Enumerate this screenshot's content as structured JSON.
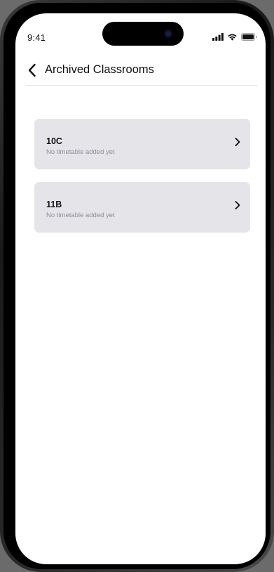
{
  "status_bar": {
    "time": "9:41"
  },
  "nav": {
    "title": "Archived Classrooms",
    "back_icon": "chevron-left-icon"
  },
  "classrooms": [
    {
      "name": "10C",
      "subtitle": "No timetable added yet"
    },
    {
      "name": "11B",
      "subtitle": "No timetable added yet"
    }
  ],
  "colors": {
    "card_background": "#e4e4e9",
    "text_primary": "#111111",
    "text_secondary": "#8e8e96",
    "screen_background": "#ffffff"
  }
}
